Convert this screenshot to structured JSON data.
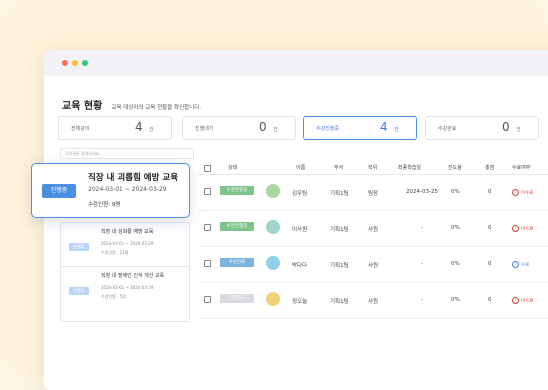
{
  "header": {
    "title": "교육 현황",
    "subtitle": "교육 대상자의 교육 현황을 확인합니다."
  },
  "stats": [
    {
      "label": "전체강의",
      "value": "4",
      "unit": "건",
      "active": false
    },
    {
      "label": "진행대기",
      "value": "0",
      "unit": "건",
      "active": false
    },
    {
      "label": "수강진행중",
      "value": "4",
      "unit": "건",
      "active": true
    },
    {
      "label": "수강완료",
      "value": "0",
      "unit": "건",
      "active": false
    }
  ],
  "search": {
    "placeholder": "강의명을 검색하세요"
  },
  "selected_course": {
    "badge": "진행중",
    "title": "직장 내 괴롭힘 예방 교육",
    "dates": "2024-03-01 ~ 2024-03-29",
    "count": "수강인원: 9명"
  },
  "courses": [
    {
      "badge": "진행중",
      "title": "직장 내 성희롱 예방 교육",
      "dates": "2024-03-01 ~ 2024-03-29",
      "count": "수강인원 : 11명"
    },
    {
      "badge": "진행중",
      "title": "직장 내 장애인 인식 개선 교육",
      "dates": "2024-03-01 ~ 2024-03-29",
      "count": "수강인원 : 5명"
    }
  ],
  "table": {
    "headers": [
      "상태",
      "이름",
      "부서",
      "직위",
      "최종학습일",
      "진도율",
      "총점",
      "수료여부"
    ],
    "rows": [
      {
        "status": "수강진행중",
        "status_color": "#7cc489",
        "name": "김우팀",
        "dept": "기획1팀",
        "position": "팀장",
        "last": "2024-03-25",
        "progress": "0%",
        "score": "0",
        "done": "미수료",
        "done_color": "#d0473b",
        "avatar": "#a8d8a0"
      },
      {
        "status": "수강진행중",
        "status_color": "#7cc489",
        "name": "이사원",
        "dept": "기획1팀",
        "position": "사원",
        "last": "-",
        "progress": "0%",
        "score": "0",
        "done": "미수료",
        "done_color": "#d0473b",
        "avatar": "#9fd4c8"
      },
      {
        "status": "수강완료",
        "status_color": "#7ab3e0",
        "name": "박다다",
        "dept": "기획1팀",
        "position": "사원",
        "last": "-",
        "progress": "0%",
        "score": "0",
        "done": "수료",
        "done_color": "#3b7ddd",
        "avatar": "#8fd0e8"
      },
      {
        "status": "진행대기",
        "status_color": "#d9dbe0",
        "name": "정오늘",
        "dept": "기획1팀",
        "position": "사원",
        "last": "-",
        "progress": "0%",
        "score": "0",
        "done": "미수료",
        "done_color": "#d0473b",
        "avatar": "#f0d27a"
      }
    ]
  }
}
